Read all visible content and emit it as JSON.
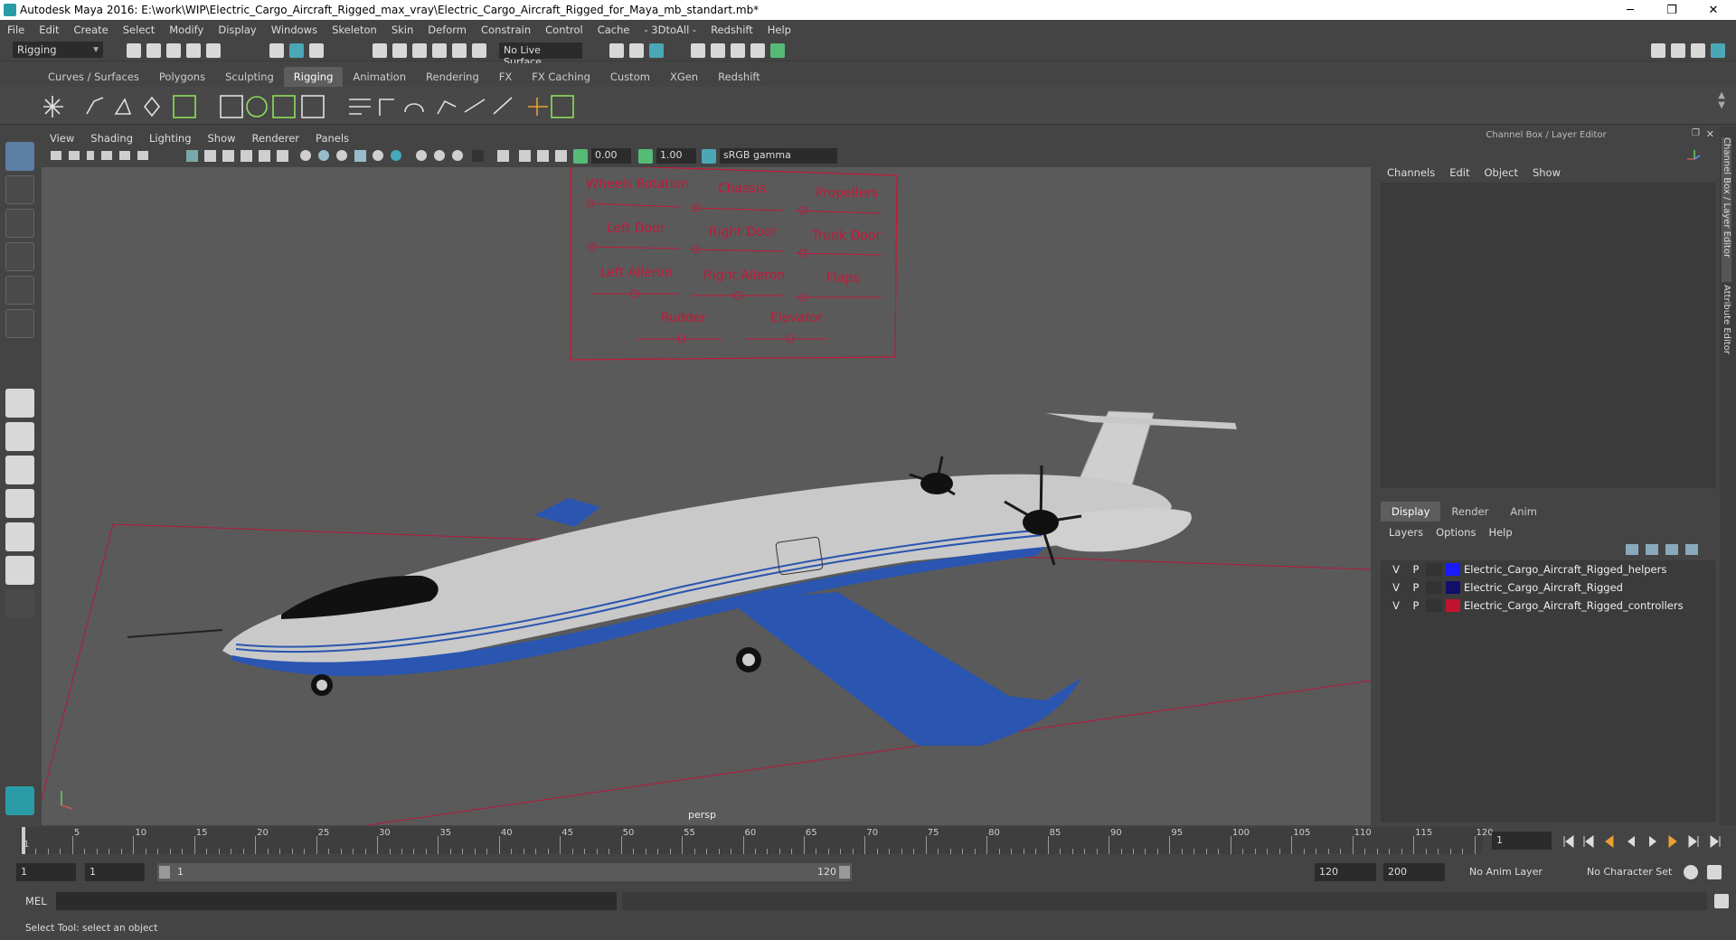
{
  "titlebar": {
    "title": "Autodesk Maya 2016: E:\\work\\WIP\\Electric_Cargo_Aircraft_Rigged_max_vray\\Electric_Cargo_Aircraft_Rigged_for_Maya_mb_standart.mb*",
    "minimize": "─",
    "maximize": "❐",
    "close": "✕"
  },
  "menubar": [
    "File",
    "Edit",
    "Create",
    "Select",
    "Modify",
    "Display",
    "Windows",
    "Skeleton",
    "Skin",
    "Deform",
    "Constrain",
    "Control",
    "Cache",
    "- 3DtoAll -",
    "Redshift",
    "Help"
  ],
  "statusline": {
    "menuset": "Rigging",
    "live_surface": "No Live Surface"
  },
  "shelf_tabs": [
    "Curves / Surfaces",
    "Polygons",
    "Sculpting",
    "Rigging",
    "Animation",
    "Rendering",
    "FX",
    "FX Caching",
    "Custom",
    "XGen",
    "Redshift"
  ],
  "active_shelf_tab": "Rigging",
  "panel_menu": [
    "View",
    "Shading",
    "Lighting",
    "Show",
    "Renderer",
    "Panels"
  ],
  "panel_tools": {
    "exposure": "0.00",
    "gamma": "1.00",
    "color_space": "sRGB gamma"
  },
  "viewport": {
    "camera": "persp",
    "controls_panel": {
      "labels": [
        "Wheels Rotation",
        "Chassis",
        "Propellers",
        "Left Door",
        "Right Door",
        "Trunk Door",
        "Left Aileron",
        "Right Aileron",
        "Flaps",
        "Rudder",
        "Elevator"
      ]
    }
  },
  "channel_box": {
    "title": "Channel Box / Layer Editor",
    "menu": [
      "Channels",
      "Edit",
      "Object",
      "Show"
    ]
  },
  "layer_editor": {
    "tabs": [
      "Display",
      "Render",
      "Anim"
    ],
    "active_tab": "Display",
    "menu": [
      "Layers",
      "Options",
      "Help"
    ],
    "layers": [
      {
        "v": "V",
        "p": "P",
        "name": "Electric_Cargo_Aircraft_Rigged_helpers",
        "color": "#1a1aff"
      },
      {
        "v": "V",
        "p": "P",
        "name": "Electric_Cargo_Aircraft_Rigged",
        "color": "#10106a"
      },
      {
        "v": "V",
        "p": "P",
        "name": "Electric_Cargo_Aircraft_Rigged_controllers",
        "color": "#c0142e"
      }
    ]
  },
  "side_tabs": {
    "channel_box": "Channel Box / Layer Editor",
    "attribute_editor": "Attribute Editor"
  },
  "timeslider": {
    "ticks": [
      "5",
      "10",
      "15",
      "20",
      "25",
      "30",
      "35",
      "40",
      "45",
      "50",
      "55",
      "60",
      "65",
      "70",
      "75",
      "80",
      "85",
      "90",
      "95",
      "100",
      "105",
      "110",
      "115",
      "120"
    ],
    "start_marker": "1",
    "current_frame": "1"
  },
  "range": {
    "start": "1",
    "playback_start": "1",
    "slider_start": "1",
    "slider_end": "120",
    "playback_end": "120",
    "end": "200",
    "anim_layer": "No Anim Layer",
    "character_set": "No Character Set"
  },
  "cmdline": {
    "label": "MEL"
  },
  "helpline": {
    "text": "Select Tool: select an object"
  }
}
